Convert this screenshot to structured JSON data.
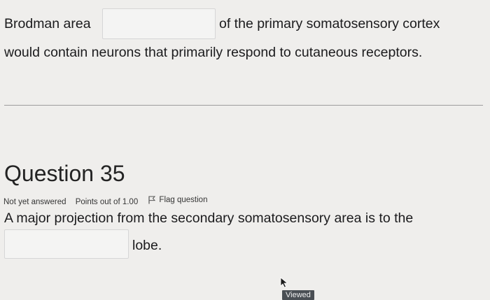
{
  "q34": {
    "prefix": "Brodman area",
    "suffix": "of the primary somatosensory cortex",
    "line2": "would contain neurons that primarily respond to cutaneous receptors.",
    "answer_value": ""
  },
  "q35": {
    "title": "Question 35",
    "status": "Not yet answered",
    "points": "Points out of 1.00",
    "flag_label": "Flag question",
    "line1": "A major projection from the secondary somatosensory area is to the",
    "suffix": "lobe.",
    "answer_value": ""
  },
  "badge": {
    "label": "Viewed"
  },
  "icons": {
    "flag": "flag-icon",
    "cursor": "mouse-pointer-icon"
  }
}
